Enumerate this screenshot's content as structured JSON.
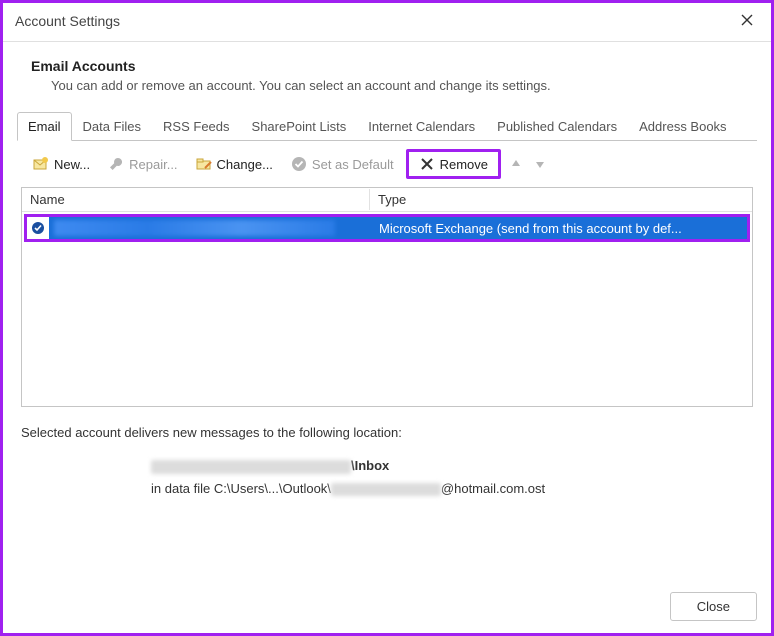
{
  "window": {
    "title": "Account Settings"
  },
  "header": {
    "title": "Email Accounts",
    "description": "You can add or remove an account. You can select an account and change its settings."
  },
  "tabs": [
    {
      "label": "Email",
      "active": true
    },
    {
      "label": "Data Files",
      "active": false
    },
    {
      "label": "RSS Feeds",
      "active": false
    },
    {
      "label": "SharePoint Lists",
      "active": false
    },
    {
      "label": "Internet Calendars",
      "active": false
    },
    {
      "label": "Published Calendars",
      "active": false
    },
    {
      "label": "Address Books",
      "active": false
    }
  ],
  "toolbar": {
    "new": "New...",
    "repair": "Repair...",
    "change": "Change...",
    "set_default": "Set as Default",
    "remove": "Remove"
  },
  "table": {
    "columns": {
      "name": "Name",
      "type": "Type"
    },
    "rows": [
      {
        "name_redacted": true,
        "type": "Microsoft Exchange (send from this account by def...",
        "is_default": true,
        "selected": true
      }
    ]
  },
  "delivery": {
    "intro": "Selected account delivers new messages to the following location:",
    "line1_suffix": "\\Inbox",
    "line2_prefix": "in data file C:\\Users\\...\\Outlook\\",
    "line2_suffix": "@hotmail.com.ost"
  },
  "footer": {
    "close": "Close"
  },
  "highlights": {
    "remove_button": true,
    "selected_row": true
  }
}
